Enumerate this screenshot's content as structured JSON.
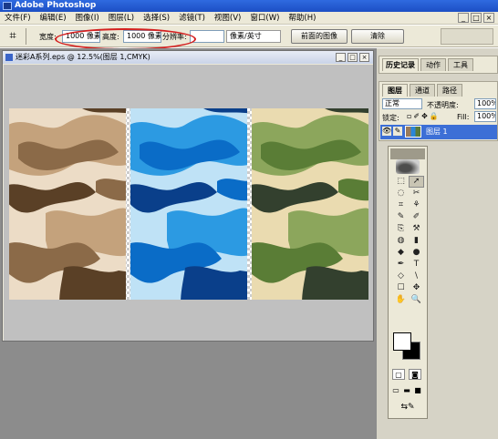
{
  "window": {
    "title": "Adobe Photoshop",
    "controls": [
      "_",
      "□",
      "×"
    ]
  },
  "menubar": [
    "文件(F)",
    "编辑(E)",
    "图像(I)",
    "图层(L)",
    "选择(S)",
    "滤镜(T)",
    "视图(V)",
    "窗口(W)",
    "帮助(H)"
  ],
  "options": {
    "width_label": "宽度:",
    "width_value": "1000 像素",
    "height_label": "高度:",
    "height_value": "1000 像素",
    "resolution_label": "分辨率:",
    "resolution_value": "",
    "unit_value": "像素/英寸",
    "front_image_button": "前面的图像",
    "clear_button": "清除"
  },
  "document": {
    "title": "迷彩A系列.eps @ 12.5%(图层 1,CMYK)",
    "controls": [
      "_",
      "□",
      "×"
    ],
    "panels": [
      {
        "name": "brown",
        "colors": [
          "#ecdcc6",
          "#c4a27c",
          "#8b6a48",
          "#5a4026"
        ]
      },
      {
        "name": "blue",
        "colors": [
          "#bfe2f6",
          "#2c9ae2",
          "#0a6cc7",
          "#0a3f8a"
        ]
      },
      {
        "name": "green",
        "colors": [
          "#eadbb0",
          "#8ca65c",
          "#5a7d36",
          "#33402e"
        ]
      }
    ]
  },
  "history_panel": {
    "tabs": [
      "历史记录",
      "动作",
      "工具"
    ]
  },
  "layers_panel": {
    "tabs": [
      "图层",
      "通道",
      "路径"
    ],
    "blend_mode": "正常",
    "opacity_label": "不透明度:",
    "opacity_value": "100%",
    "lock_label": "锁定:",
    "fill_label": "Fill:",
    "fill_value": "100%",
    "layer_name": "图层 1"
  },
  "toolbox": {
    "tools": [
      "⬚",
      "➚",
      "◌",
      "✂",
      "⌗",
      "⚘",
      "✎",
      "✐",
      "⎘",
      "⚒",
      "◍",
      "▮",
      "◆",
      "●",
      "✒",
      "T",
      "◇",
      "\\",
      "☐",
      "✥",
      "✋",
      "🔍"
    ],
    "selected_index": 1
  }
}
